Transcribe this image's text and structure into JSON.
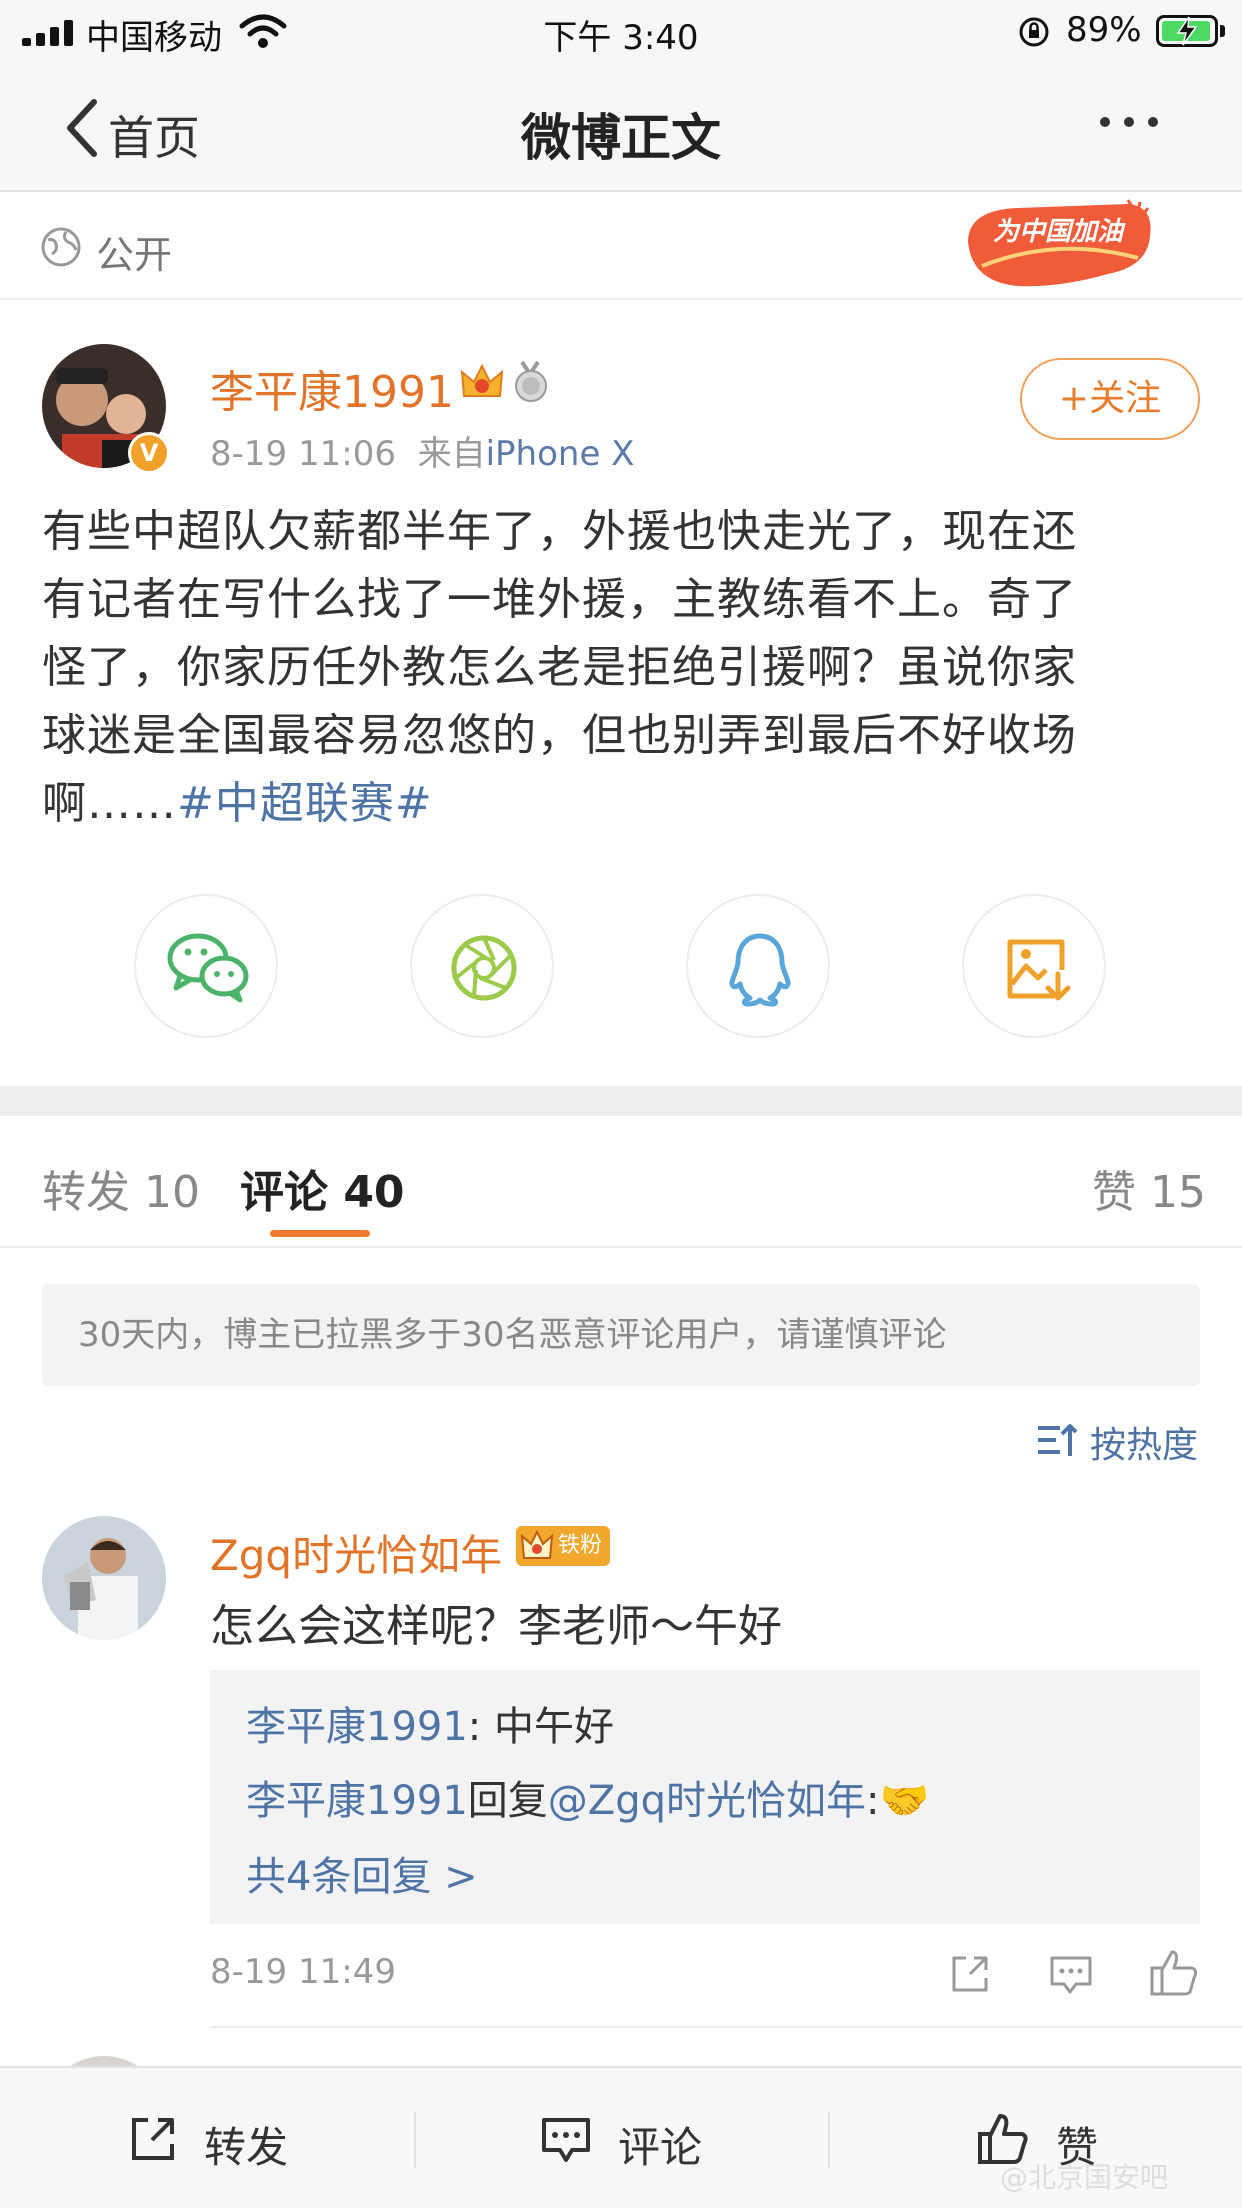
{
  "status_bar": {
    "carrier": "中国移动",
    "time": "下午 3:40",
    "battery": "89%"
  },
  "nav": {
    "back_label": "首页",
    "title": "微博正文"
  },
  "visibility": {
    "label": "公开",
    "badge_text": "为中国加油"
  },
  "post": {
    "author": "李平康1991",
    "time": "8-19 11:06",
    "source_prefix": "来自",
    "source": "iPhone X",
    "follow_label": "+关注",
    "text_lines": [
      "有些中超队欠薪都半年了，外援也快走光了，现在还",
      "有记者在写什么找了一堆外援，主教练看不上。奇了",
      "怪了，你家历任外教怎么老是拒绝引援啊？虽说你家",
      "球迷是全国最容易忽悠的，但也别弄到最后不好收场"
    ],
    "text_last": "啊……",
    "topic": "#中超联赛#",
    "verified_mark": "V"
  },
  "tabs": {
    "repost": "转发 10",
    "comment": "评论 40",
    "like": "赞 15"
  },
  "notice": "30天内，博主已拉黑多于30名恶意评论用户，请谨慎评论",
  "sort_label": "按热度",
  "comment": {
    "author": "Zgq时光恰如年",
    "badge": "铁粉",
    "text": "怎么会这样呢？李老师～午好",
    "replies": [
      {
        "user": "李平康1991",
        "sep": ": ",
        "text": "中午好"
      },
      {
        "user": "李平康1991",
        "mid": "回复",
        "mention": "@Zgq时光恰如年",
        "tail": ":🤝"
      }
    ],
    "more": "共4条回复 >",
    "time": "8-19 11:49"
  },
  "bottom_bar": {
    "repost": "转发",
    "comment": "评论",
    "like": "赞"
  },
  "watermark": "@北京国安吧",
  "colors": {
    "orange": "#e2742a",
    "link_blue": "#4e74a6",
    "wechat_green": "#4cb46a",
    "moments_green": "#9ccb4a",
    "qq_blue": "#5aa6d8",
    "save_orange": "#f0a12a"
  }
}
